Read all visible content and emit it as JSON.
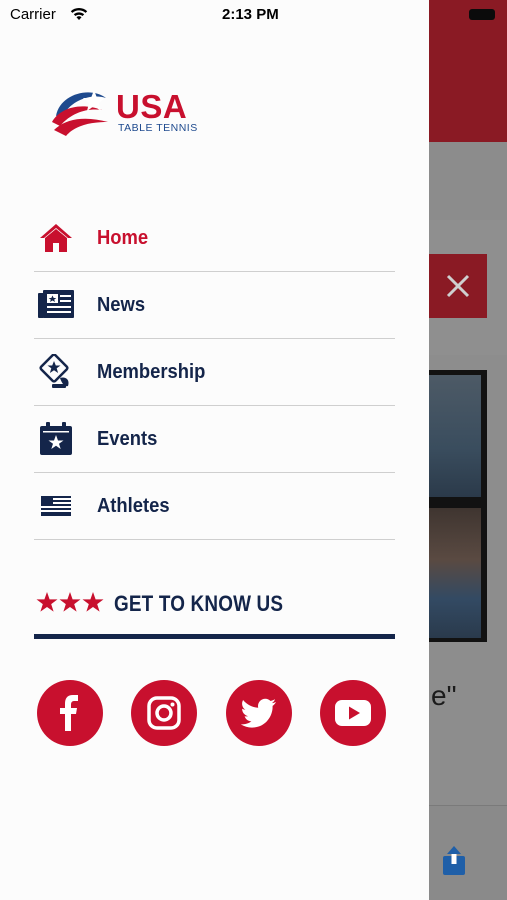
{
  "status_bar": {
    "carrier": "Carrier",
    "time": "2:13 PM"
  },
  "logo": {
    "text": "USA",
    "subtitle": "TABLE TENNIS"
  },
  "menu": {
    "items": [
      {
        "label": "Home",
        "icon": "home-icon",
        "active": true
      },
      {
        "label": "News",
        "icon": "news-icon",
        "active": false
      },
      {
        "label": "Membership",
        "icon": "membership-icon",
        "active": false
      },
      {
        "label": "Events",
        "icon": "calendar-icon",
        "active": false
      },
      {
        "label": "Athletes",
        "icon": "us-flag-icon",
        "active": false
      }
    ]
  },
  "get_to_know": {
    "title": "GET TO KNOW US"
  },
  "social": [
    {
      "name": "facebook-icon"
    },
    {
      "name": "instagram-icon"
    },
    {
      "name": "twitter-icon"
    },
    {
      "name": "youtube-icon"
    }
  ],
  "background_app": {
    "quote_fragment": "e\""
  },
  "colors": {
    "brand_red": "#c8102e",
    "navy": "#14254a",
    "divider": "#cfcfcf"
  }
}
